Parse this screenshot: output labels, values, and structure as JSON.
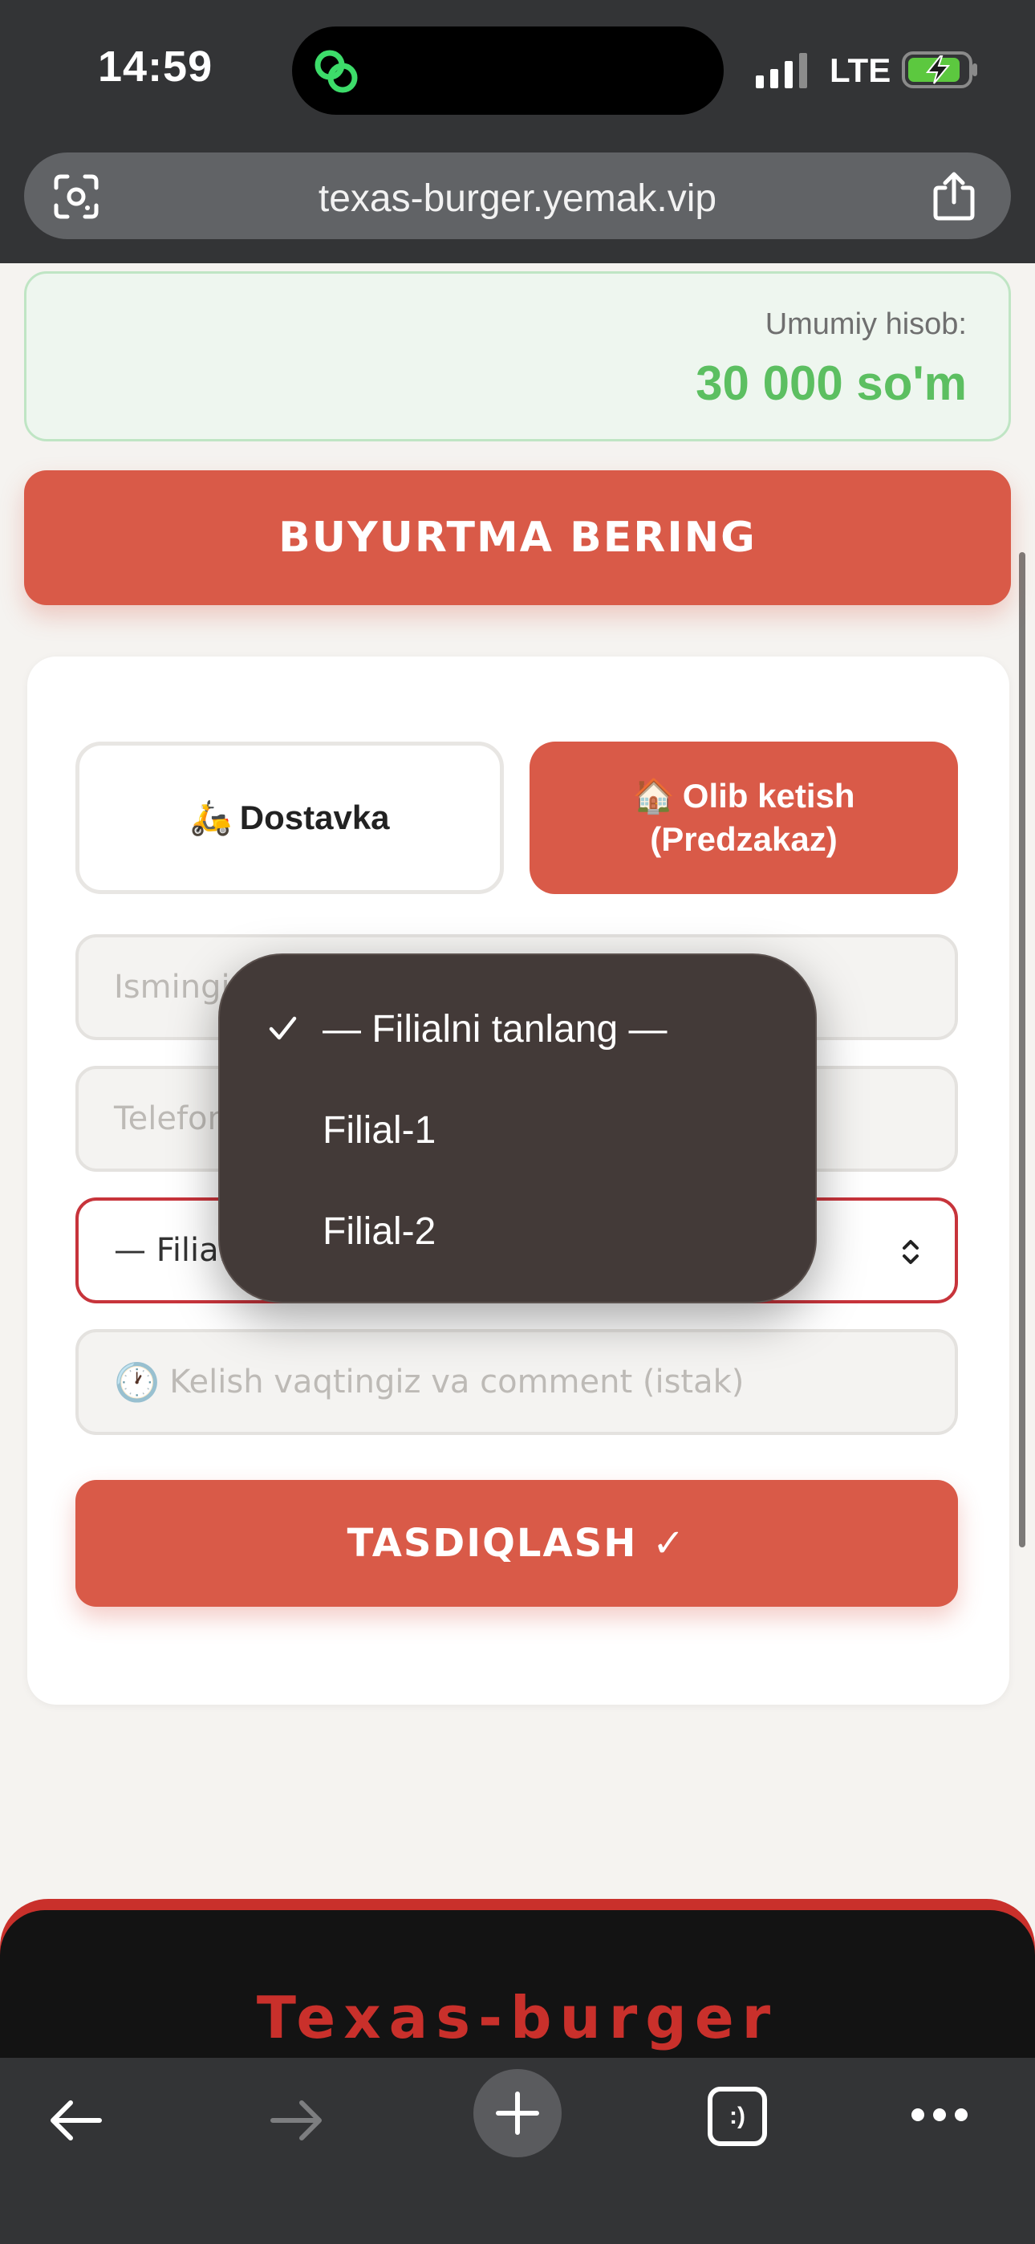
{
  "status_bar": {
    "time": "14:59",
    "network": "LTE"
  },
  "browser": {
    "url": "texas-burger.yemak.vip"
  },
  "summary": {
    "total_label": "Umumiy hisob:",
    "total_value": "30 000 so'm"
  },
  "order_button_label": "BUYURTMA BERING",
  "delivery_modes": [
    {
      "icon": "🛵",
      "label": "Dostavka",
      "selected": false
    },
    {
      "icon": "🏠",
      "label": "Olib ketish (Predzakaz)",
      "selected": true
    }
  ],
  "form": {
    "name_placeholder": "Ismingiz",
    "phone_placeholder": "Telefon",
    "branch_value": "— Filialni tanlang —",
    "comment_placeholder": "Kelish vaqtingiz va comment (istak)",
    "comment_icon": "🕐",
    "confirm_label": "TASDIQLASH ✓"
  },
  "branch_dropdown": {
    "options": [
      "— Filialni tanlang —",
      "Filial-1",
      "Filial-2"
    ],
    "selected_index": 0
  },
  "footer": {
    "brand": "Texas-burger"
  },
  "toolbar": {
    "tabs_label": ":)"
  },
  "colors": {
    "accent": "#d95a48",
    "total_green": "#5cbf61",
    "select_border": "#c7343b",
    "brand_red": "#c9302b",
    "chrome": "#333436"
  }
}
